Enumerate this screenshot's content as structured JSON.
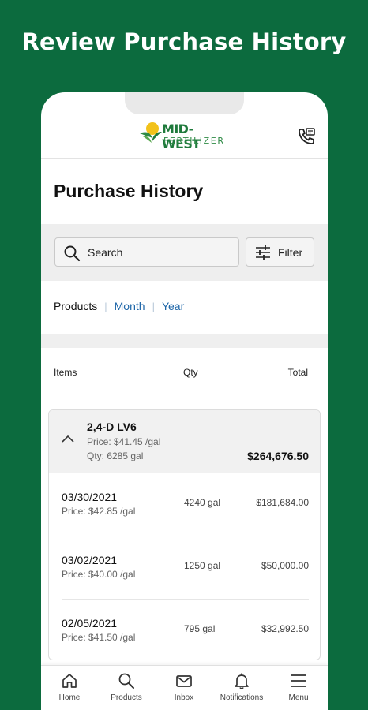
{
  "promo": {
    "title": "Review Purchase History"
  },
  "header": {
    "logo_top": "MID-WEST",
    "logo_bottom": "FERTILIZER",
    "phone_icon": "phone-contact-icon"
  },
  "page": {
    "title": "Purchase History"
  },
  "search": {
    "placeholder": "Search",
    "filter_label": "Filter"
  },
  "tabs": [
    {
      "label": "Products",
      "active": true
    },
    {
      "label": "Month",
      "active": false
    },
    {
      "label": "Year",
      "active": false
    }
  ],
  "table": {
    "headers": {
      "items": "Items",
      "qty": "Qty",
      "total": "Total"
    }
  },
  "product": {
    "name": "2,4-D LV6",
    "price": "Price: $41.45 /gal",
    "qty": "Qty: 6285 gal",
    "total": "$264,676.50",
    "expanded": true,
    "rows": [
      {
        "date": "03/30/2021",
        "price": "Price: $42.85 /gal",
        "qty": "4240 gal",
        "total": "$181,684.00"
      },
      {
        "date": "03/02/2021",
        "price": "Price: $40.00 /gal",
        "qty": "1250 gal",
        "total": "$50,000.00"
      },
      {
        "date": "02/05/2021",
        "price": "Price: $41.50 /gal",
        "qty": "795 gal",
        "total": "$32,992.50"
      }
    ]
  },
  "nav": [
    {
      "label": "Home",
      "icon": "home-icon"
    },
    {
      "label": "Products",
      "icon": "search-icon"
    },
    {
      "label": "Inbox",
      "icon": "mail-icon"
    },
    {
      "label": "Notifications",
      "icon": "bell-icon"
    },
    {
      "label": "Menu",
      "icon": "menu-icon"
    }
  ],
  "colors": {
    "background": "#0c6b3e",
    "accent_link": "#1e66a8",
    "logo_green": "#1f7a3c",
    "logo_yellow": "#f2c21b"
  }
}
